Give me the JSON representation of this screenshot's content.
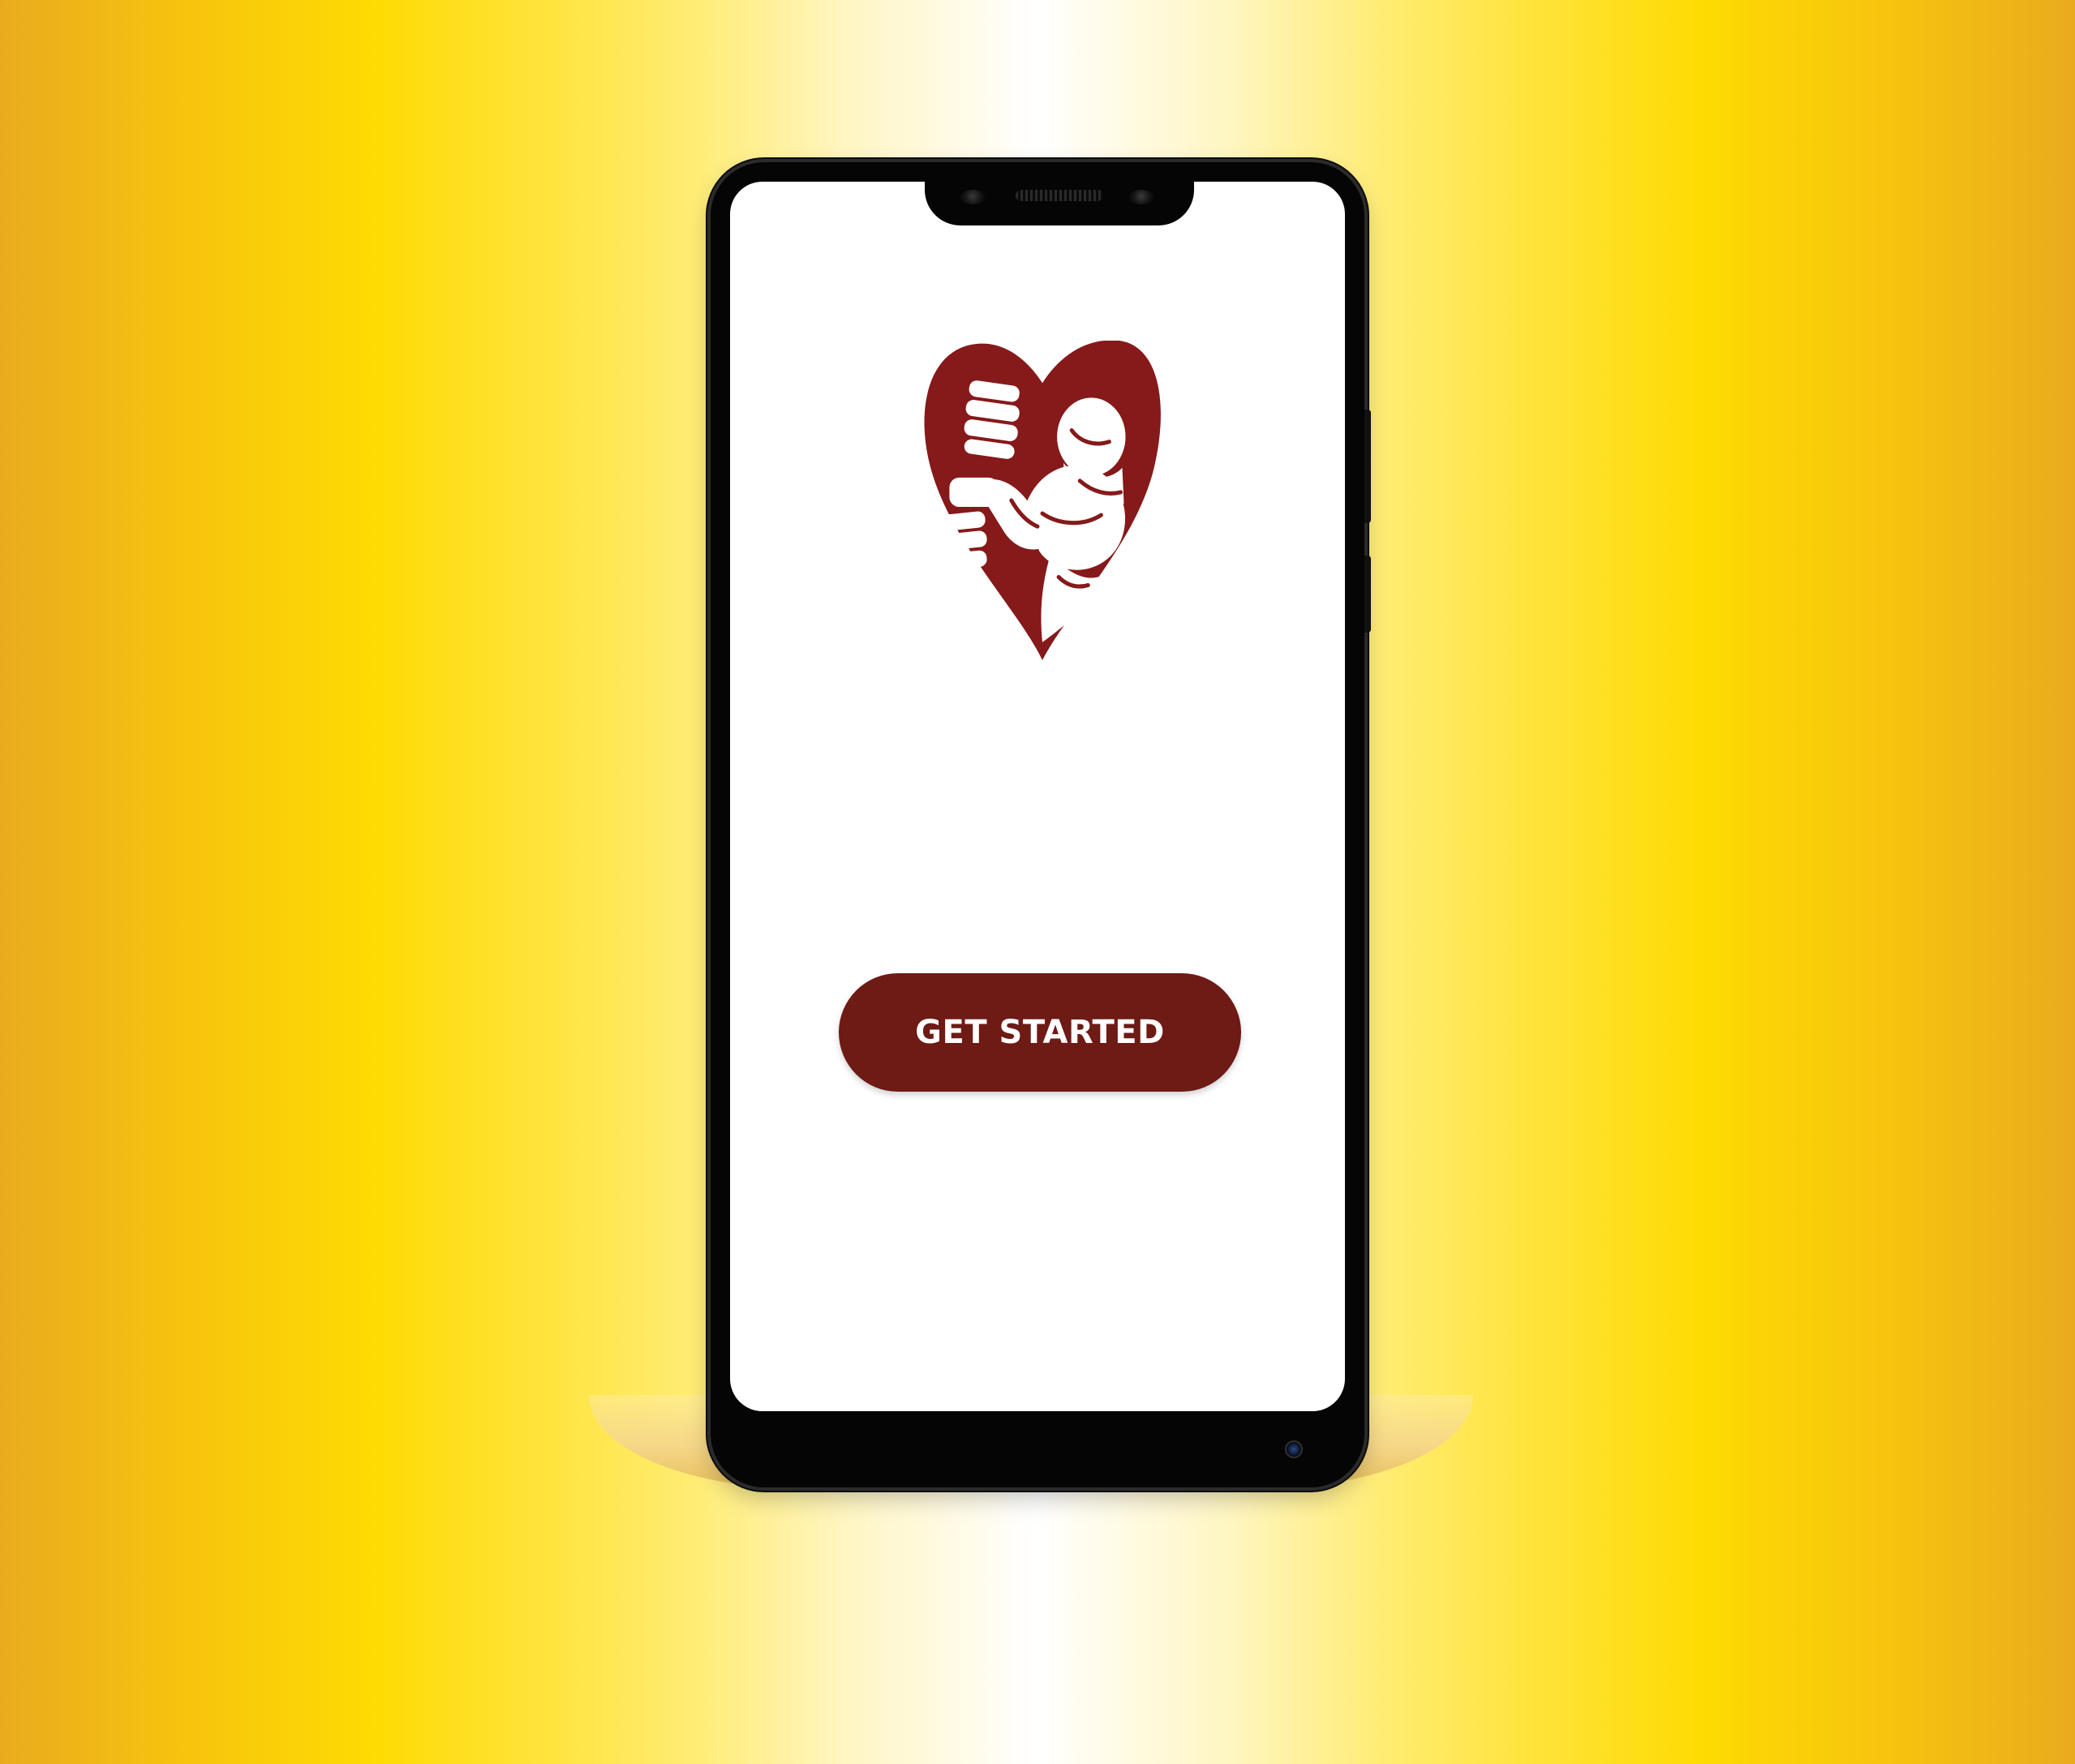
{
  "background": {
    "gradient_edge_color": "#e9ab1e",
    "gradient_mid_color": "#fedb02",
    "gradient_center_color": "#ffffff"
  },
  "device": {
    "frame_color": "#050505",
    "screen_color": "#ffffff"
  },
  "app": {
    "logo_icon": "heart-bodybuilder-logo",
    "brand_color": "#6e1a15",
    "get_started_label": "GET STARTED"
  }
}
